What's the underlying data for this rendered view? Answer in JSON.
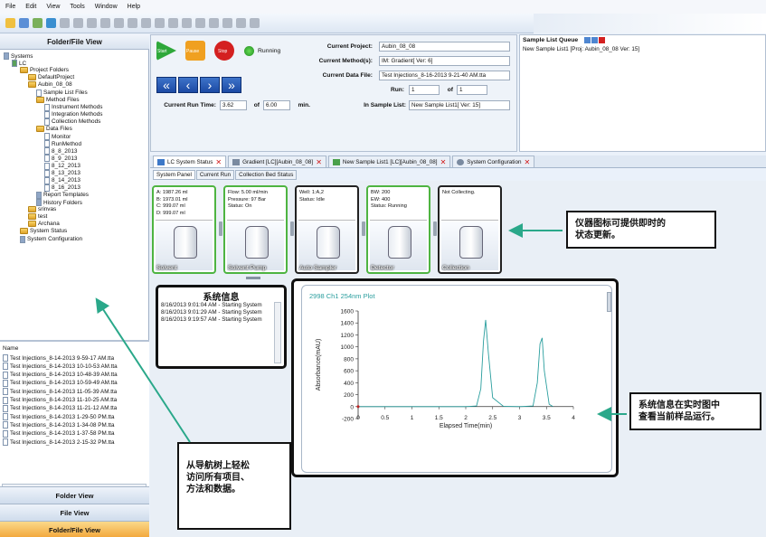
{
  "menu": [
    "File",
    "Edit",
    "View",
    "Tools",
    "Window",
    "Help"
  ],
  "nav": {
    "title": "Folder/File View",
    "tree": [
      {
        "label": "Systems",
        "level": 0,
        "icon": "systems-icon"
      },
      {
        "label": "LC",
        "level": 1,
        "icon": "lc-icon"
      },
      {
        "label": "Project Folders",
        "level": 2,
        "icon": "folder-icon"
      },
      {
        "label": "DefaultProject",
        "level": 3,
        "icon": "folder-icon"
      },
      {
        "label": "Aubin_08_08",
        "level": 3,
        "icon": "folder-icon"
      },
      {
        "label": "Sample List Files",
        "level": 4,
        "icon": "file-icon"
      },
      {
        "label": "Method Files",
        "level": 4,
        "icon": "folder-icon"
      },
      {
        "label": "Instrument Methods",
        "level": 5,
        "icon": "file-icon"
      },
      {
        "label": "Integration Methods",
        "level": 5,
        "icon": "file-icon"
      },
      {
        "label": "Collection Methods",
        "level": 5,
        "icon": "file-icon"
      },
      {
        "label": "Data Files",
        "level": 4,
        "icon": "folder-icon"
      },
      {
        "label": "Monitor",
        "level": 5,
        "icon": "file-icon"
      },
      {
        "label": "RunMethod",
        "level": 5,
        "icon": "file-icon"
      },
      {
        "label": "8_8_2013",
        "level": 5,
        "icon": "file-icon"
      },
      {
        "label": "8_9_2013",
        "level": 5,
        "icon": "file-icon"
      },
      {
        "label": "8_12_2013",
        "level": 5,
        "icon": "file-icon"
      },
      {
        "label": "8_13_2013",
        "level": 5,
        "icon": "file-icon"
      },
      {
        "label": "8_14_2013",
        "level": 5,
        "icon": "file-icon"
      },
      {
        "label": "8_16_2013",
        "level": 5,
        "icon": "file-icon"
      },
      {
        "label": "Report Templates",
        "level": 4,
        "icon": "pencil-icon"
      },
      {
        "label": "History Folders",
        "level": 4,
        "icon": "history-icon"
      },
      {
        "label": "srinvas",
        "level": 3,
        "icon": "folder-icon"
      },
      {
        "label": "test",
        "level": 3,
        "icon": "folder-icon"
      },
      {
        "label": "Archana",
        "level": 3,
        "icon": "folder-icon"
      },
      {
        "label": "System Status",
        "level": 2,
        "icon": "folder-icon"
      },
      {
        "label": "System Configuration",
        "level": 2,
        "icon": "gear-icon"
      }
    ],
    "list_header": "Name",
    "files": [
      "Test Injections_8-14-2013 9-59-17 AM.tta",
      "Test Injections_8-14-2013 10-10-53 AM.tta",
      "Test Injections_8-14-2013 10-48-39 AM.tta",
      "Test Injections_8-14-2013 10-59-49 AM.tta",
      "Test Injections_8-14-2013 11-05-39 AM.tta",
      "Test Injections_8-14-2013 11-10-25 AM.tta",
      "Test Injections_8-14-2013 11-21-12 AM.tta",
      "Test Injections_8-14-2013 1-29-50 PM.tta",
      "Test Injections_8-14-2013 1-34-08 PM.tta",
      "Test Injections_8-14-2013 1-37-58 PM.tta",
      "Test Injections_8-14-2013 2-15-32 PM.tta"
    ],
    "buttons": [
      "Folder View",
      "File View",
      "Folder/File View"
    ]
  },
  "control": {
    "start": "Start",
    "pause": "Pause",
    "stop": "Stop",
    "status": "Running",
    "project_label": "Current Project:",
    "project": "Aubin_08_08",
    "method_label": "Current Method(s):",
    "method": "IM: Gradient[ Ver: 6]",
    "datafile_label": "Current Data File:",
    "datafile": "Test Injections_8-16-2013 9-21-40 AM.tta",
    "run_label": "Run:",
    "run": "1",
    "of_label": "of",
    "run_total": "1",
    "runtime_label": "Current Run Time:",
    "runtime": "3.62",
    "runtime_of": "of",
    "runtime_total": "6.00",
    "runtime_unit": "min.",
    "samplelist_label": "In Sample List:",
    "samplelist": "New Sample List1[ Ver: 15]"
  },
  "queue": {
    "title": "Sample List Queue",
    "item": "New Sample List1   [Proj: Aubin_08_08   Ver: 15]"
  },
  "tabs": [
    "LC System Status",
    "Gradient [LC][Aubin_08_08]",
    "New Sample List1 [LC][Aubin_08_08]",
    "System Configuration"
  ],
  "subtabs": [
    "System Panel",
    "Current Run",
    "Collection Bed Status"
  ],
  "cards": [
    {
      "name": "Solvent",
      "lines": [
        "A: 1987.26 ml",
        "B: 1973.01 ml",
        "C: 999.07 ml",
        "D: 999.07 ml"
      ],
      "color": "green"
    },
    {
      "name": "Solvent Pump",
      "lines": [
        "Flow: 5.00 ml/min",
        "Pressure: 97 Bar",
        "Status: On"
      ],
      "color": "green"
    },
    {
      "name": "Auto Sampler",
      "lines": [
        "Well: 1:A,2",
        "Status: Idle"
      ],
      "color": "black"
    },
    {
      "name": "Detector",
      "lines": [
        "BW: 200",
        "EW: 400",
        "Status: Running"
      ],
      "color": "green"
    },
    {
      "name": "Collection",
      "lines": [
        "Not Collecting."
      ],
      "color": "black"
    }
  ],
  "sysinfo": {
    "title": "系统信息",
    "log": "8/16/2013 9:01:04 AM - Starting System\n8/16/2013 9:01:29 AM - Starting System\n8/16/2013 9:19:57 AM - Starting System"
  },
  "plot": {
    "title": "2998 Ch1 254nm Plot",
    "xlabel": "Elapsed Time(min)",
    "ylabel": "Absorbance(mAU)"
  },
  "chart_data": {
    "type": "line",
    "title": "2998 Ch1 254nm Plot",
    "xlabel": "Elapsed Time(min)",
    "ylabel": "Absorbance(mAU)",
    "xlim": [
      0,
      4
    ],
    "ylim": [
      -200,
      1600
    ],
    "xticks": [
      "0",
      "0.5",
      "1",
      "1.5",
      "2",
      "2.5",
      "3",
      "3.5",
      "4"
    ],
    "yticks": [
      "-200",
      "0",
      "200",
      "400",
      "600",
      "800",
      "1000",
      "1200",
      "1400",
      "1600"
    ],
    "series": [
      {
        "x": [
          0,
          0.5,
          1,
          1.5,
          2.0,
          2.2,
          2.28,
          2.33,
          2.37,
          2.42,
          2.5,
          2.7,
          3.0,
          3.25,
          3.33,
          3.38,
          3.42,
          3.46,
          3.55,
          3.62
        ],
        "y": [
          0,
          0,
          0,
          0,
          0,
          10,
          300,
          1100,
          1450,
          900,
          150,
          5,
          0,
          10,
          400,
          1050,
          1150,
          600,
          40,
          0
        ]
      }
    ],
    "color": "#2a9e9e"
  },
  "callouts": {
    "icons": "仪器图标可提供即时的\n状态更新。",
    "plot": "系统信息在实时图中\n查看当前样品运行。",
    "nav": "从导航树上轻松\n访问所有项目、\n方法和数据。"
  },
  "colors": {
    "accent": "#2aa88a",
    "green_border": "#4eb441"
  }
}
